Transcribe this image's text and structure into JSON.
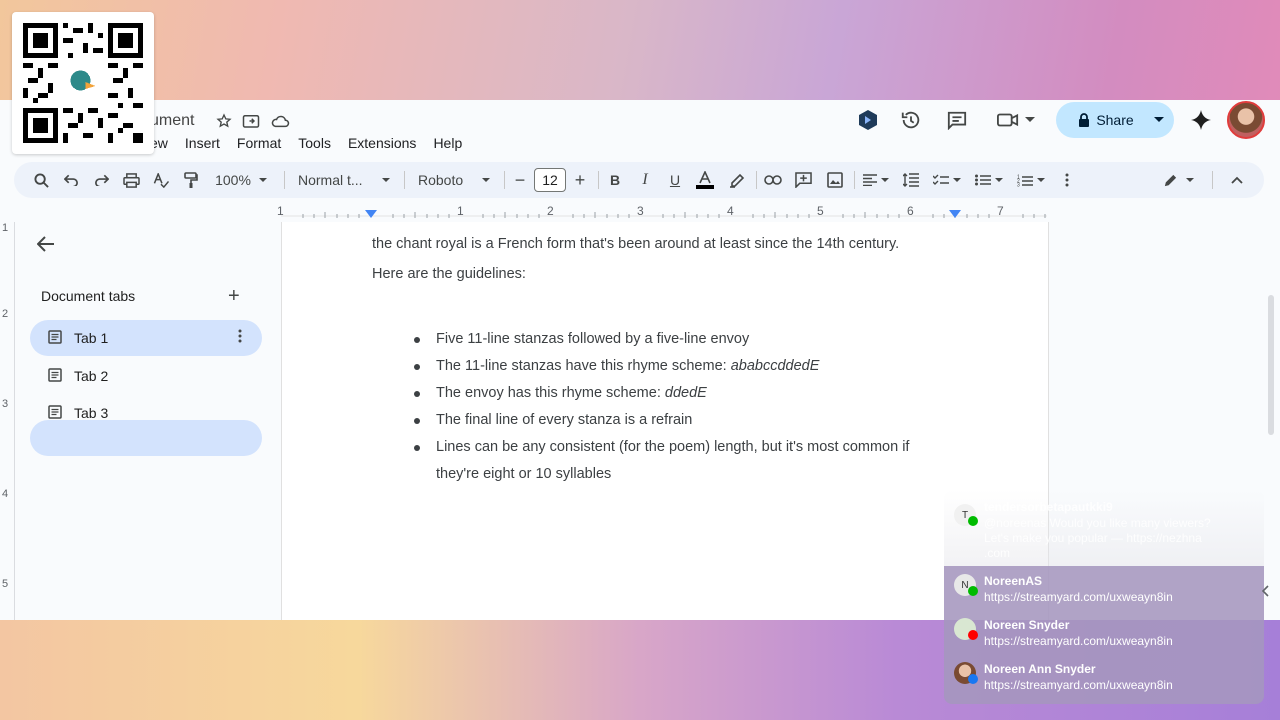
{
  "doc": {
    "title": "ument",
    "menu": [
      "ew",
      "Insert",
      "Format",
      "Tools",
      "Extensions",
      "Help"
    ]
  },
  "header": {
    "share_label": "Share"
  },
  "toolbar": {
    "zoom": "100%",
    "style": "Normal t...",
    "font": "Roboto",
    "font_size": "12"
  },
  "ruler": {
    "numbers": [
      "1",
      "1",
      "2",
      "3",
      "4",
      "5",
      "6",
      "7"
    ]
  },
  "vruler": {
    "numbers": [
      "1",
      "2",
      "3",
      "4",
      "5"
    ]
  },
  "sidebar": {
    "header": "Document tabs",
    "tabs": [
      {
        "label": "Tab 1",
        "active": true
      },
      {
        "label": "Tab 2",
        "active": false
      },
      {
        "label": "Tab 3",
        "active": false
      }
    ]
  },
  "page": {
    "line1": "the chant royal is a French form that's been around at least since the 14th century.",
    "line2": "Here are the guidelines:",
    "bullets": [
      {
        "text": "Five 11-line stanzas followed by a five-line envoy",
        "em": ""
      },
      {
        "text": "The 11-line stanzas have this rhyme scheme: ",
        "em": "ababccddedE"
      },
      {
        "text": "The envoy has this rhyme scheme: ",
        "em": "ddedE"
      },
      {
        "text": "The final line of every stanza is a refrain",
        "em": ""
      },
      {
        "text": "Lines can be any consistent (for the poem) length, but it's most common if they're eight or 10 syllables",
        "em": ""
      }
    ]
  },
  "chat": {
    "messages": [
      {
        "initial": "T",
        "name": "tendersorbetapautkki9",
        "text": "@noreenas Would you like many viewers? Let's make you popular — https://nezhna .com",
        "platform": "x"
      },
      {
        "initial": "N",
        "name": "NoreenAS",
        "text": "https://streamyard.com/uxweayn8in",
        "platform": "x"
      },
      {
        "initial": "",
        "name": "Noreen Snyder",
        "text": "https://streamyard.com/uxweayn8in",
        "platform": "youtube"
      },
      {
        "initial": "",
        "name": "Noreen Ann Snyder",
        "text": "https://streamyard.com/uxweayn8in",
        "platform": "facebook"
      }
    ]
  },
  "colors": {
    "share_bg": "#c2e7ff",
    "active_tab": "#d3e3fd",
    "toolbar_bg": "#edf2fa",
    "marker": "#4285f4"
  }
}
